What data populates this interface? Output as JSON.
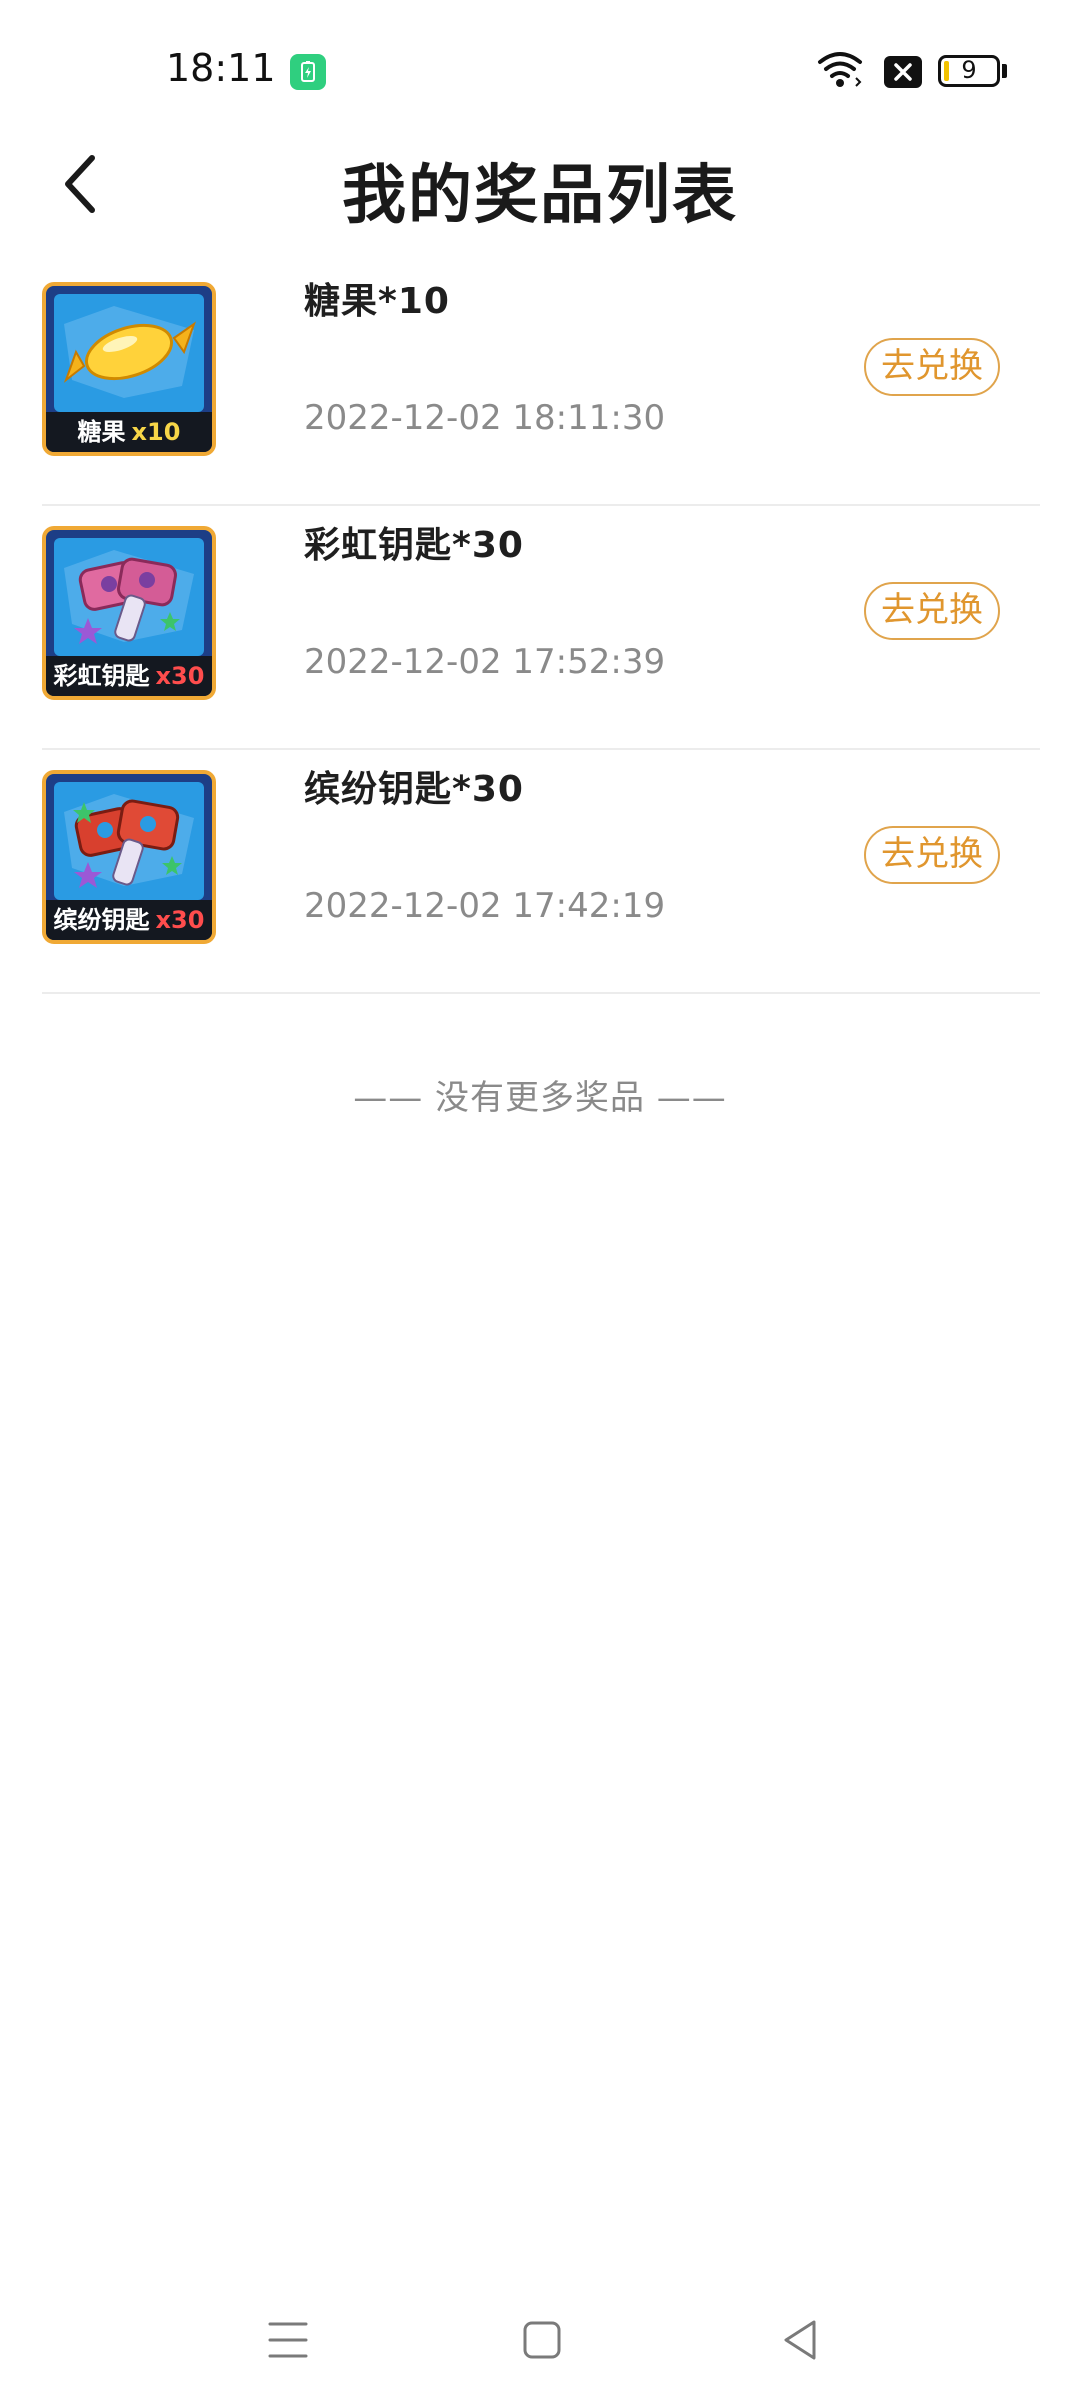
{
  "status_bar": {
    "time": "18:11",
    "battery_level": "9",
    "battery_percent": 9,
    "icons": [
      "battery-saver-icon",
      "wifi-icon",
      "close-badge-icon",
      "battery-icon"
    ]
  },
  "header": {
    "title": "我的奖品列表",
    "back_icon": "chevron-left-icon"
  },
  "prizes": [
    {
      "name": "糖果*10",
      "time": "2022-12-02 18:11:30",
      "button": "去兑换",
      "thumb_label": "糖果",
      "thumb_qty": "x10"
    },
    {
      "name": "彩虹钥匙*30",
      "time": "2022-12-02 17:52:39",
      "button": "去兑换",
      "thumb_label": "彩虹钥匙",
      "thumb_qty": "x30"
    },
    {
      "name": "缤纷钥匙*30",
      "time": "2022-12-02 17:42:19",
      "button": "去兑换",
      "thumb_label": "缤纷钥匙",
      "thumb_qty": "x30"
    }
  ],
  "footer_text": "—— 没有更多奖品 ——",
  "nav_bar": {
    "icons": [
      "menu-icon",
      "home-icon",
      "back-triangle-icon"
    ]
  },
  "colors": {
    "accent": "#e0962e",
    "thumb_border": "#f0a935",
    "thumb_bg": "#2a9be3",
    "divider": "#ececec",
    "muted_text": "#8a8a8a"
  }
}
